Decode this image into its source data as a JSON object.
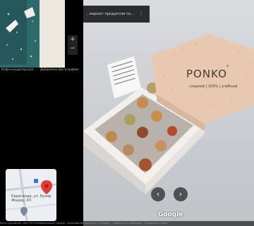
{
  "thumbnail": {
    "caption": "Кафе-кондитерская ... · Добавлено фотографом"
  },
  "zoom": {
    "plus": "+",
    "minus": "−"
  },
  "viewer": {
    "title": "...маркет продуктов по...",
    "menu_icon": "⋮"
  },
  "minimap": {
    "label": "Караганда, ул. Бухар Жырау, 43"
  },
  "package": {
    "brand": "PONKO",
    "brand_mark": "°",
    "tagline": "сладкий | 100% | учебный"
  },
  "navigation": {
    "prev": "‹",
    "next": "›"
  },
  "attribution": "Google",
  "footer": "Фото: дизайнер, май 2023   Изображение: Google · Конфиденциальность · Условия · Сообщить о проблеме · Отправить отзыв",
  "colors": {
    "box_pink": "#e7c9b2",
    "tray_white": "#f4f1ee",
    "thumb_teal": "#2e6f73",
    "map_pin": "#e53935"
  }
}
